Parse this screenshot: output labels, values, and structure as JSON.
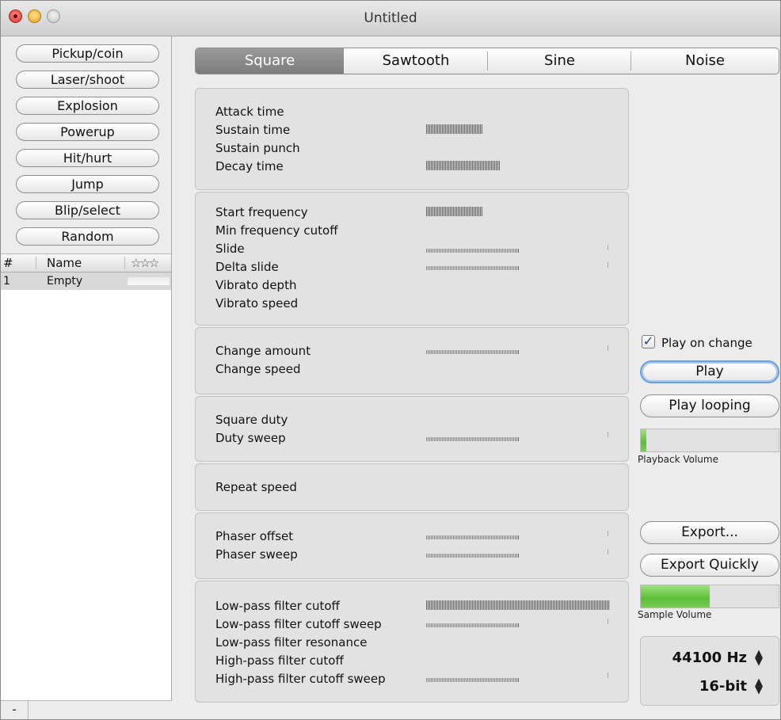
{
  "window": {
    "title": "Untitled"
  },
  "presets": [
    "Pickup/coin",
    "Laser/shoot",
    "Explosion",
    "Powerup",
    "Hit/hurt",
    "Jump",
    "Blip/select",
    "Random"
  ],
  "sound_list": {
    "headers": {
      "number": "#",
      "name": "Name",
      "rating": "☆☆☆"
    },
    "rows": [
      {
        "number": "1",
        "name": "Empty"
      }
    ],
    "remove_label": "-"
  },
  "waveforms": {
    "items": [
      "Square",
      "Sawtooth",
      "Sine",
      "Noise"
    ],
    "selected": "Square"
  },
  "groups": {
    "envelope": [
      "Attack time",
      "Sustain time",
      "Sustain punch",
      "Decay time"
    ],
    "frequency": [
      "Start frequency",
      "Min frequency cutoff",
      "Slide",
      "Delta slide",
      "Vibrato depth",
      "Vibrato speed"
    ],
    "change": [
      "Change amount",
      "Change speed"
    ],
    "duty": [
      "Square duty",
      "Duty sweep"
    ],
    "repeat": [
      "Repeat speed"
    ],
    "phaser": [
      "Phaser offset",
      "Phaser sweep"
    ],
    "filters": [
      "Low-pass filter cutoff",
      "Low-pass filter cutoff sweep",
      "Low-pass filter resonance",
      "High-pass filter cutoff",
      "High-pass filter cutoff sweep"
    ]
  },
  "controls": {
    "play_on_change_label": "Play on change",
    "play_on_change_checked": true,
    "play_label": "Play",
    "play_looping_label": "Play looping",
    "playback_volume_label": "Playback Volume",
    "playback_volume_level": 0.04,
    "export_label": "Export...",
    "export_quickly_label": "Export Quickly",
    "sample_volume_label": "Sample Volume",
    "sample_volume_level": 0.5,
    "sample_rate": "44100 Hz",
    "bit_depth": "16-bit"
  },
  "colors": {
    "volume_fill": "#5bbf36",
    "selected_segment": "#8a8a8a",
    "focus_ring": "#6d9fd8"
  }
}
